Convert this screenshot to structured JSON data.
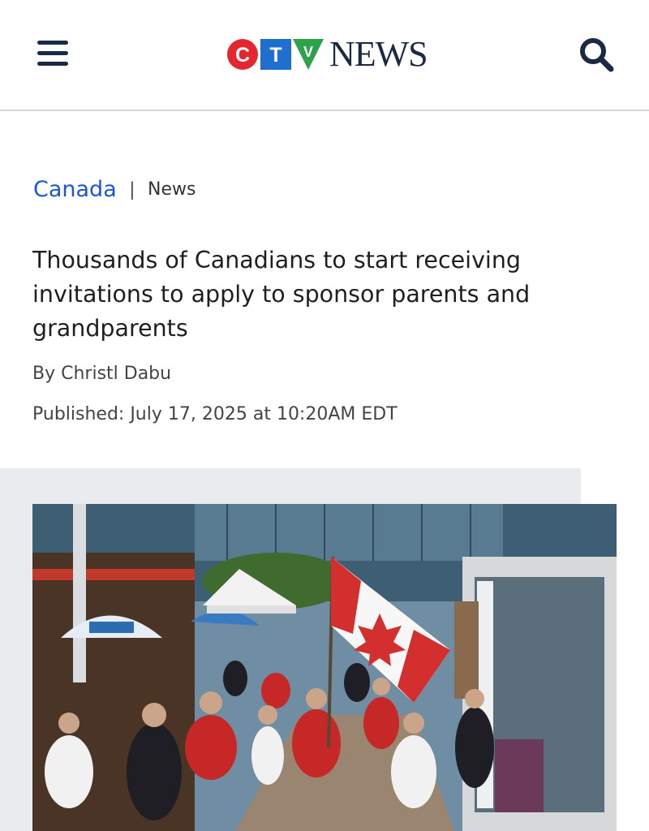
{
  "header": {
    "logo_ctv_letters": [
      "C",
      "T",
      "V"
    ],
    "logo_news": "NEWS",
    "colors": {
      "c_red": "#e3262f",
      "t_blue": "#1f6fcf",
      "v_green": "#2aa34a",
      "navy": "#1b2a44"
    }
  },
  "breadcrumb": {
    "section": "Canada",
    "separator": "|",
    "subsection": "News"
  },
  "article": {
    "headline": "Thousands of Canadians to start receiving invitations to apply to sponsor parents and grandparents",
    "byline": "By Christl Dabu",
    "published": "Published: July 17, 2025 at 10:20AM EDT"
  },
  "accent_color": "#1a56db"
}
